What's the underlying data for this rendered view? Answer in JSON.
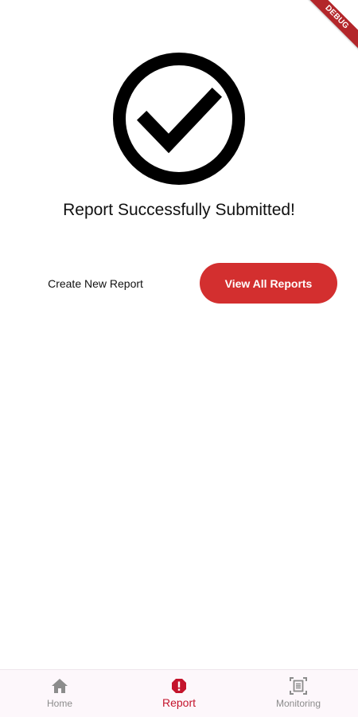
{
  "banner": {
    "text": "DEBUG"
  },
  "success": {
    "icon": "check-circle-icon",
    "title": "Report Successfully Submitted!"
  },
  "actions": {
    "create_label": "Create New Report",
    "view_label": "View All Reports"
  },
  "nav": {
    "items": [
      {
        "label": "Home",
        "icon": "home-icon",
        "active": false
      },
      {
        "label": "Report",
        "icon": "report-alert-icon",
        "active": true
      },
      {
        "label": "Monitoring",
        "icon": "monitoring-icon",
        "active": false
      }
    ]
  },
  "colors": {
    "accent": "#d32f2f",
    "active_nav": "#c4142c",
    "inactive_nav": "#8c8c8c"
  }
}
